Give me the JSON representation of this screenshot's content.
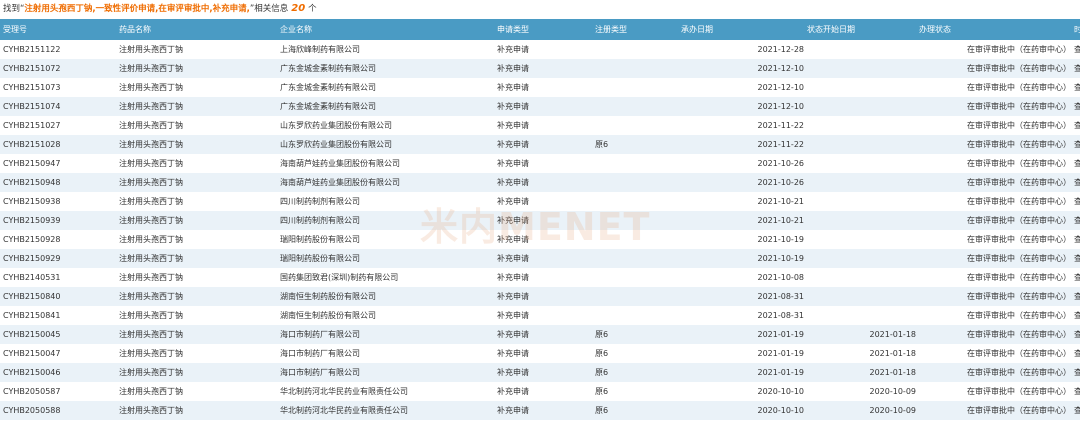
{
  "summary": {
    "prefix": "找到“",
    "query": "注射用头孢西丁钠,一致性评价申请,在审评审批中,补充申请,",
    "middle": "”相关信息",
    "count": "20",
    "suffix": "个"
  },
  "columns": {
    "id": "受理号",
    "drug": "药品名称",
    "company": "企业名称",
    "app_type": "申请类型",
    "reg_type": "注册类型",
    "date": "承办日期",
    "start_date": "状态开始日期",
    "status": "办理状态",
    "time": "时间轴"
  },
  "watermark": "米内MENET",
  "rows": [
    {
      "id": "CYHB2151122",
      "drug": "注射用头孢西丁钠",
      "company": "上海欣峰制药有限公司",
      "app_type": "补充申请",
      "reg_type": "",
      "date": "2021-12-28",
      "start_date": "",
      "status": "在审评审批中（在药审中心）",
      "view": "查看"
    },
    {
      "id": "CYHB2151072",
      "drug": "注射用头孢西丁钠",
      "company": "广东金城金素制药有限公司",
      "app_type": "补充申请",
      "reg_type": "",
      "date": "2021-12-10",
      "start_date": "",
      "status": "在审评审批中（在药审中心）",
      "view": "查看"
    },
    {
      "id": "CYHB2151073",
      "drug": "注射用头孢西丁钠",
      "company": "广东金城金素制药有限公司",
      "app_type": "补充申请",
      "reg_type": "",
      "date": "2021-12-10",
      "start_date": "",
      "status": "在审评审批中（在药审中心）",
      "view": "查看"
    },
    {
      "id": "CYHB2151074",
      "drug": "注射用头孢西丁钠",
      "company": "广东金城金素制药有限公司",
      "app_type": "补充申请",
      "reg_type": "",
      "date": "2021-12-10",
      "start_date": "",
      "status": "在审评审批中（在药审中心）",
      "view": "查看"
    },
    {
      "id": "CYHB2151027",
      "drug": "注射用头孢西丁钠",
      "company": "山东罗欣药业集团股份有限公司",
      "app_type": "补充申请",
      "reg_type": "",
      "date": "2021-11-22",
      "start_date": "",
      "status": "在审评审批中（在药审中心）",
      "view": "查看"
    },
    {
      "id": "CYHB2151028",
      "drug": "注射用头孢西丁钠",
      "company": "山东罗欣药业集团股份有限公司",
      "app_type": "补充申请",
      "reg_type": "原6",
      "date": "2021-11-22",
      "start_date": "",
      "status": "在审评审批中（在药审中心）",
      "view": "查看"
    },
    {
      "id": "CYHB2150947",
      "drug": "注射用头孢西丁钠",
      "company": "海南葫芦娃药业集团股份有限公司",
      "app_type": "补充申请",
      "reg_type": "",
      "date": "2021-10-26",
      "start_date": "",
      "status": "在审评审批中（在药审中心）",
      "view": "查看"
    },
    {
      "id": "CYHB2150948",
      "drug": "注射用头孢西丁钠",
      "company": "海南葫芦娃药业集团股份有限公司",
      "app_type": "补充申请",
      "reg_type": "",
      "date": "2021-10-26",
      "start_date": "",
      "status": "在审评审批中（在药审中心）",
      "view": "查看"
    },
    {
      "id": "CYHB2150938",
      "drug": "注射用头孢西丁钠",
      "company": "四川制药制剂有限公司",
      "app_type": "补充申请",
      "reg_type": "",
      "date": "2021-10-21",
      "start_date": "",
      "status": "在审评审批中（在药审中心）",
      "view": "查看"
    },
    {
      "id": "CYHB2150939",
      "drug": "注射用头孢西丁钠",
      "company": "四川制药制剂有限公司",
      "app_type": "补充申请",
      "reg_type": "",
      "date": "2021-10-21",
      "start_date": "",
      "status": "在审评审批中（在药审中心）",
      "view": "查看"
    },
    {
      "id": "CYHB2150928",
      "drug": "注射用头孢西丁钠",
      "company": "瑞阳制药股份有限公司",
      "app_type": "补充申请",
      "reg_type": "",
      "date": "2021-10-19",
      "start_date": "",
      "status": "在审评审批中（在药审中心）",
      "view": "查看"
    },
    {
      "id": "CYHB2150929",
      "drug": "注射用头孢西丁钠",
      "company": "瑞阳制药股份有限公司",
      "app_type": "补充申请",
      "reg_type": "",
      "date": "2021-10-19",
      "start_date": "",
      "status": "在审评审批中（在药审中心）",
      "view": "查看"
    },
    {
      "id": "CYHB2140531",
      "drug": "注射用头孢西丁钠",
      "company": "国药集团致君(深圳)制药有限公司",
      "app_type": "补充申请",
      "reg_type": "",
      "date": "2021-10-08",
      "start_date": "",
      "status": "在审评审批中（在药审中心）",
      "view": "查看"
    },
    {
      "id": "CYHB2150840",
      "drug": "注射用头孢西丁钠",
      "company": "湖南恒生制药股份有限公司",
      "app_type": "补充申请",
      "reg_type": "",
      "date": "2021-08-31",
      "start_date": "",
      "status": "在审评审批中（在药审中心）",
      "view": "查看"
    },
    {
      "id": "CYHB2150841",
      "drug": "注射用头孢西丁钠",
      "company": "湖南恒生制药股份有限公司",
      "app_type": "补充申请",
      "reg_type": "",
      "date": "2021-08-31",
      "start_date": "",
      "status": "在审评审批中（在药审中心）",
      "view": "查看"
    },
    {
      "id": "CYHB2150045",
      "drug": "注射用头孢西丁钠",
      "company": "海口市制药厂有限公司",
      "app_type": "补充申请",
      "reg_type": "原6",
      "date": "2021-01-19",
      "start_date": "2021-01-18",
      "status": "在审评审批中（在药审中心）",
      "view": "查看"
    },
    {
      "id": "CYHB2150047",
      "drug": "注射用头孢西丁钠",
      "company": "海口市制药厂有限公司",
      "app_type": "补充申请",
      "reg_type": "原6",
      "date": "2021-01-19",
      "start_date": "2021-01-18",
      "status": "在审评审批中（在药审中心）",
      "view": "查看"
    },
    {
      "id": "CYHB2150046",
      "drug": "注射用头孢西丁钠",
      "company": "海口市制药厂有限公司",
      "app_type": "补充申请",
      "reg_type": "原6",
      "date": "2021-01-19",
      "start_date": "2021-01-18",
      "status": "在审评审批中（在药审中心）",
      "view": "查看"
    },
    {
      "id": "CYHB2050587",
      "drug": "注射用头孢西丁钠",
      "company": "华北制药河北华民药业有限责任公司",
      "app_type": "补充申请",
      "reg_type": "原6",
      "date": "2020-10-10",
      "start_date": "2020-10-09",
      "status": "在审评审批中（在药审中心）",
      "view": "查看"
    },
    {
      "id": "CYHB2050588",
      "drug": "注射用头孢西丁钠",
      "company": "华北制药河北华民药业有限责任公司",
      "app_type": "补充申请",
      "reg_type": "原6",
      "date": "2020-10-10",
      "start_date": "2020-10-09",
      "status": "在审评审批中（在药审中心）",
      "view": "查看"
    }
  ]
}
